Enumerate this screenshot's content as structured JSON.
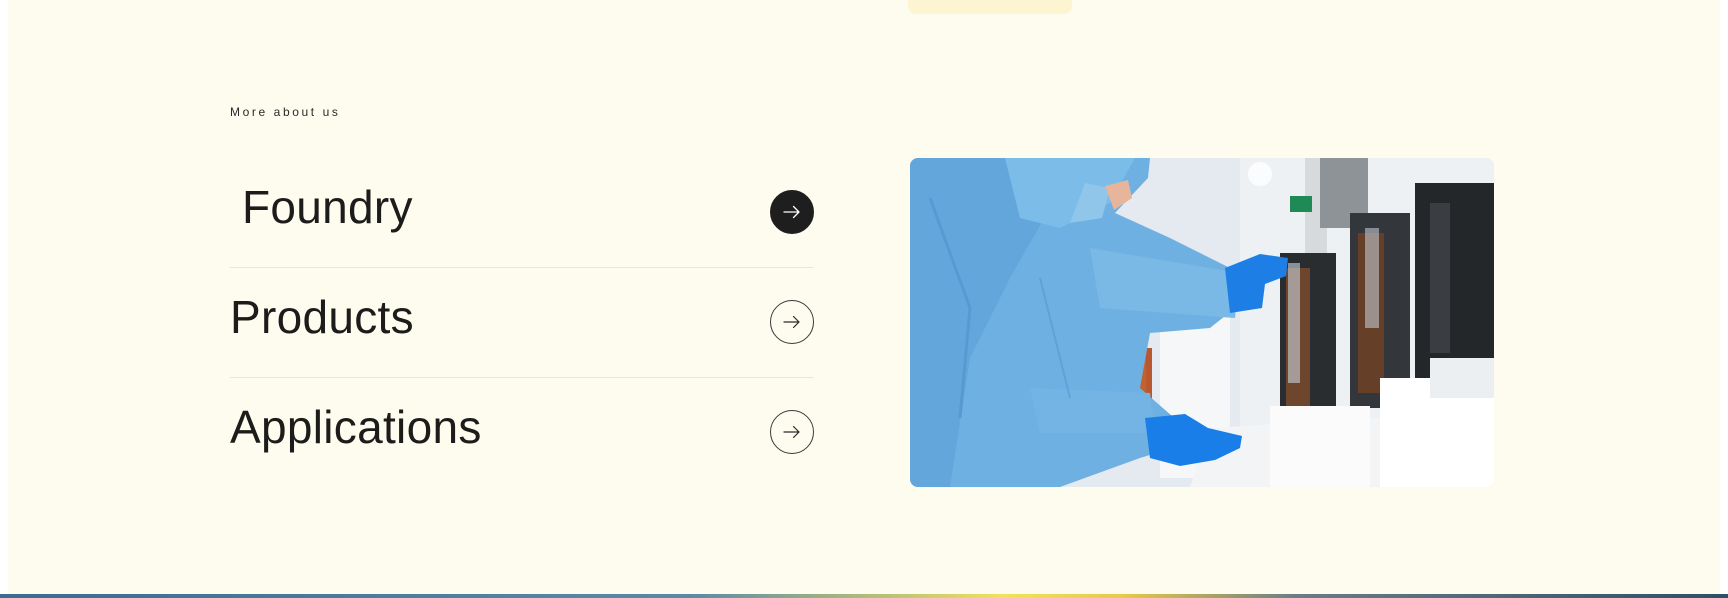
{
  "section": {
    "eyebrow": "More about us"
  },
  "menu": {
    "items": [
      {
        "label": "Foundry",
        "icon": "arrow-right-icon",
        "active": true
      },
      {
        "label": "Products",
        "icon": "arrow-right-icon",
        "active": false
      },
      {
        "label": "Applications",
        "icon": "arrow-right-icon",
        "active": false
      }
    ]
  },
  "colors": {
    "background": "#fefbef",
    "text": "#1c1c1a",
    "active_button": "#1e1e1e",
    "divider": "#ebe7d7"
  },
  "photo": {
    "subject": "cleanroom-worker-photo"
  }
}
